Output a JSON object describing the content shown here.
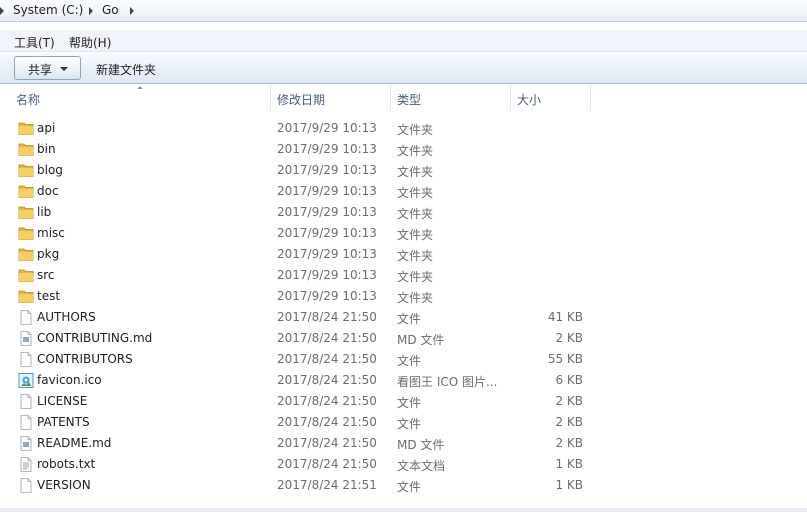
{
  "address": {
    "root": "System (C:)",
    "current": "Go"
  },
  "menu": {
    "tools": "工具(T)",
    "help": "帮助(H)"
  },
  "toolbar": {
    "share": "共享",
    "new_folder": "新建文件夹"
  },
  "columns": {
    "name": "名称",
    "date": "修改日期",
    "type": "类型",
    "size": "大小"
  },
  "files": [
    {
      "name": "api",
      "date": "2017/9/29 10:13",
      "type": "文件夹",
      "size": "",
      "icon": "folder-icon"
    },
    {
      "name": "bin",
      "date": "2017/9/29 10:13",
      "type": "文件夹",
      "size": "",
      "icon": "folder-icon"
    },
    {
      "name": "blog",
      "date": "2017/9/29 10:13",
      "type": "文件夹",
      "size": "",
      "icon": "folder-icon"
    },
    {
      "name": "doc",
      "date": "2017/9/29 10:13",
      "type": "文件夹",
      "size": "",
      "icon": "folder-icon"
    },
    {
      "name": "lib",
      "date": "2017/9/29 10:13",
      "type": "文件夹",
      "size": "",
      "icon": "folder-icon"
    },
    {
      "name": "misc",
      "date": "2017/9/29 10:13",
      "type": "文件夹",
      "size": "",
      "icon": "folder-icon"
    },
    {
      "name": "pkg",
      "date": "2017/9/29 10:13",
      "type": "文件夹",
      "size": "",
      "icon": "folder-icon"
    },
    {
      "name": "src",
      "date": "2017/9/29 10:13",
      "type": "文件夹",
      "size": "",
      "icon": "folder-icon"
    },
    {
      "name": "test",
      "date": "2017/9/29 10:13",
      "type": "文件夹",
      "size": "",
      "icon": "folder-icon"
    },
    {
      "name": "AUTHORS",
      "date": "2017/8/24 21:50",
      "type": "文件",
      "size": "41 KB",
      "icon": "file-icon"
    },
    {
      "name": "CONTRIBUTING.md",
      "date": "2017/8/24 21:50",
      "type": "MD 文件",
      "size": "2 KB",
      "icon": "md-file-icon"
    },
    {
      "name": "CONTRIBUTORS",
      "date": "2017/8/24 21:50",
      "type": "文件",
      "size": "55 KB",
      "icon": "file-icon"
    },
    {
      "name": "favicon.ico",
      "date": "2017/8/24 21:50",
      "type": "看图王 ICO 图片...",
      "size": "6 KB",
      "icon": "image-file-icon"
    },
    {
      "name": "LICENSE",
      "date": "2017/8/24 21:50",
      "type": "文件",
      "size": "2 KB",
      "icon": "file-icon"
    },
    {
      "name": "PATENTS",
      "date": "2017/8/24 21:50",
      "type": "文件",
      "size": "2 KB",
      "icon": "file-icon"
    },
    {
      "name": "README.md",
      "date": "2017/8/24 21:50",
      "type": "MD 文件",
      "size": "2 KB",
      "icon": "md-file-icon"
    },
    {
      "name": "robots.txt",
      "date": "2017/8/24 21:50",
      "type": "文本文档",
      "size": "1 KB",
      "icon": "text-file-icon"
    },
    {
      "name": "VERSION",
      "date": "2017/8/24 21:51",
      "type": "文件",
      "size": "1 KB",
      "icon": "file-icon"
    }
  ]
}
